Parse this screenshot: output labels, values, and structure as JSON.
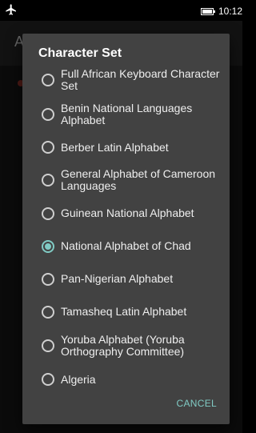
{
  "status_bar": {
    "time": "10:12"
  },
  "app_bar": {
    "title": "A"
  },
  "dialog": {
    "title": "Character Set",
    "options": [
      {
        "label": "Full African Keyboard Character Set",
        "checked": false
      },
      {
        "label": "Benin National Languages Alphabet",
        "checked": false
      },
      {
        "label": "Berber Latin Alphabet",
        "checked": false
      },
      {
        "label": "General Alphabet of Cameroon Languages",
        "checked": false
      },
      {
        "label": "Guinean National Alphabet",
        "checked": false
      },
      {
        "label": "National Alphabet of Chad",
        "checked": true
      },
      {
        "label": "Pan-Nigerian Alphabet",
        "checked": false
      },
      {
        "label": "Tamasheq Latin Alphabet",
        "checked": false
      },
      {
        "label": "Yoruba Alphabet (Yoruba Orthography Committee)",
        "checked": false
      },
      {
        "label": "Algeria",
        "checked": false
      }
    ],
    "cancel_label": "CANCEL"
  },
  "colors": {
    "accent": "#80cbc4",
    "dialog_bg": "#424242"
  }
}
